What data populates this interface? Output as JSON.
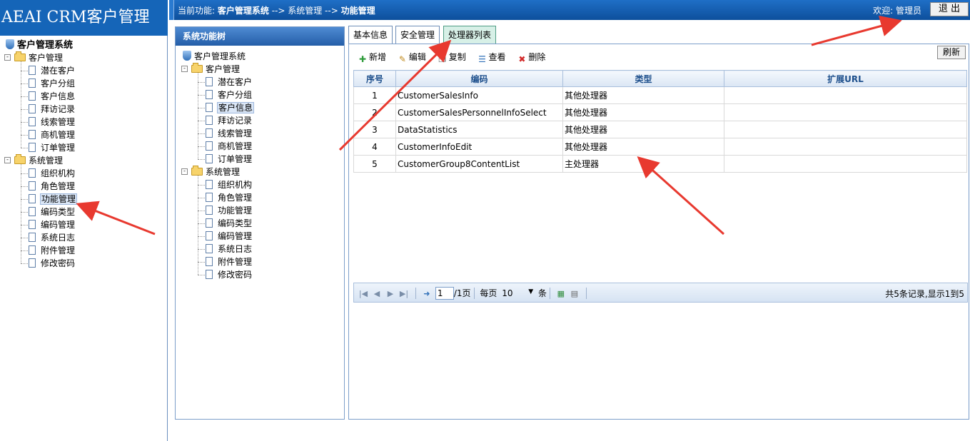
{
  "app": {
    "title": "AEAI CRM客户管理"
  },
  "topbar": {
    "crumb_prefix": "当前功能: ",
    "crumb_1": "客户管理系统",
    "crumb_sep1": " --> ",
    "crumb_2": "系统管理",
    "crumb_sep2": " --> ",
    "crumb_3": "功能管理",
    "welcome": "欢迎: 管理员",
    "logout": "退 出"
  },
  "left_tree": {
    "root": "客户管理系统",
    "group1": "客户管理",
    "group1_items": [
      "潜在客户",
      "客户分组",
      "客户信息",
      "拜访记录",
      "线索管理",
      "商机管理",
      "订单管理"
    ],
    "group2": "系统管理",
    "group2_items": [
      "组织机构",
      "角色管理",
      "功能管理",
      "编码类型",
      "编码管理",
      "系统日志",
      "附件管理",
      "修改密码"
    ]
  },
  "func_tree": {
    "header": "系统功能树",
    "root": "客户管理系统",
    "group1": "客户管理",
    "group1_items": [
      "潜在客户",
      "客户分组",
      "客户信息",
      "拜访记录",
      "线索管理",
      "商机管理",
      "订单管理"
    ],
    "group2": "系统管理",
    "group2_items": [
      "组织机构",
      "角色管理",
      "功能管理",
      "编码类型",
      "编码管理",
      "系统日志",
      "附件管理",
      "修改密码"
    ]
  },
  "tabs": [
    {
      "label": "基本信息"
    },
    {
      "label": "安全管理"
    },
    {
      "label": "处理器列表"
    }
  ],
  "toolbar": {
    "add": "新增",
    "edit": "编辑",
    "copy": "复制",
    "view": "查看",
    "delete": "删除",
    "refresh": "刷新"
  },
  "grid": {
    "headers": [
      "序号",
      "编码",
      "类型",
      "扩展URL"
    ],
    "rows": [
      {
        "no": "1",
        "code": "CustomerSalesInfo",
        "type": "其他处理器",
        "url": ""
      },
      {
        "no": "2",
        "code": "CustomerSalesPersonnelInfoSelect",
        "type": "其他处理器",
        "url": ""
      },
      {
        "no": "3",
        "code": "DataStatistics",
        "type": "其他处理器",
        "url": ""
      },
      {
        "no": "4",
        "code": "CustomerInfoEdit",
        "type": "其他处理器",
        "url": ""
      },
      {
        "no": "5",
        "code": "CustomerGroup8ContentList",
        "type": "主处理器",
        "url": ""
      }
    ]
  },
  "pager": {
    "page_value": "1",
    "page_total": "/1页",
    "per_page_label": "每页",
    "per_page_value": "10",
    "unit": "条",
    "summary": "共5条记录,显示1到5"
  },
  "colors": {
    "brand": "#1565b8",
    "arrow": "#e8392f",
    "active_tab": "#d7f0e7"
  }
}
